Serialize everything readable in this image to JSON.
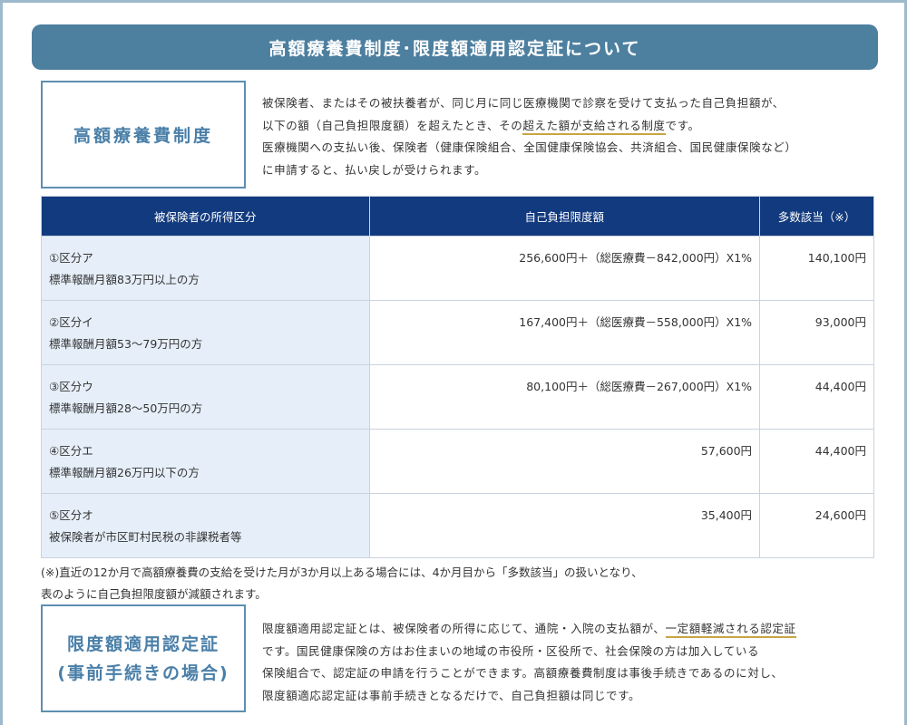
{
  "title": "高額療養費制度･限度額適用認定証について",
  "section1": {
    "label": "高額療養費制度",
    "p1_a": "被保険者、またはその被扶養者が、同じ月に同じ医療機関で診察を受けて支払った自己負担額が、",
    "p1_b_pre": "以下の額（自己負担限度額）を超えたとき、その",
    "p1_b_ul": "超えた額が支給される制度",
    "p1_b_post": "です。",
    "p1_c": "医療機関への支払い後、保険者（健康保険組合、全国健康保険協会、共済組合、国民健康保険など）",
    "p1_d": "に申請すると、払い戻しが受けられます。"
  },
  "table": {
    "headers": [
      "被保険者の所得区分",
      "自己負担限度額",
      "多数該当（※）"
    ],
    "rows": [
      {
        "cat": "①区分ア",
        "desc": "標準報酬月額83万円以上の方",
        "amount": "256,600円＋（総医療費－842,000円）X1%",
        "multi": "140,100円"
      },
      {
        "cat": "②区分イ",
        "desc": "標準報酬月額53～79万円の方",
        "amount": "167,400円＋（総医療費－558,000円）X1%",
        "multi": "93,000円"
      },
      {
        "cat": "③区分ウ",
        "desc": "標準報酬月額28～50万円の方",
        "amount": "80,100円＋（総医療費－267,000円）X1%",
        "multi": "44,400円"
      },
      {
        "cat": "④区分エ",
        "desc": "標準報酬月額26万円以下の方",
        "amount": "57,600円",
        "multi": "44,400円"
      },
      {
        "cat": "⑤区分オ",
        "desc": "被保険者が市区町村民税の非課税者等",
        "amount": "35,400円",
        "multi": "24,600円"
      }
    ]
  },
  "note": {
    "line1": "(※)直近の12か月で高額療養費の支給を受けた月が3か月以上ある場合には、4か月目から「多数該当」の扱いとなり、",
    "line2": "表のように自己負担限度額が減額されます。"
  },
  "section2": {
    "label_line1": "限度額適用認定証",
    "label_line2": "(事前手続きの場合)",
    "p2_a_pre": "限度額適用認定証とは、被保険者の所得に応じて、通院・入院の支払額が、",
    "p2_a_ul": "一定額軽減される認定証",
    "p2_b": "です。国民健康保険の方はお住まいの地域の市役所・区役所で、社会保険の方は加入している",
    "p2_c": "保険組合で、認定証の申請を行うことができます。高額療養費制度は事後手続きであるのに対し、",
    "p2_d": "限度額適応認定証は事前手続きとなるだけで、自己負担額は同じです。"
  },
  "colors": {
    "title_bg": "#4d7f9f",
    "table_header": "#123a7e",
    "category_bg": "#e6eff9",
    "accent_underline": "#c6a544"
  }
}
